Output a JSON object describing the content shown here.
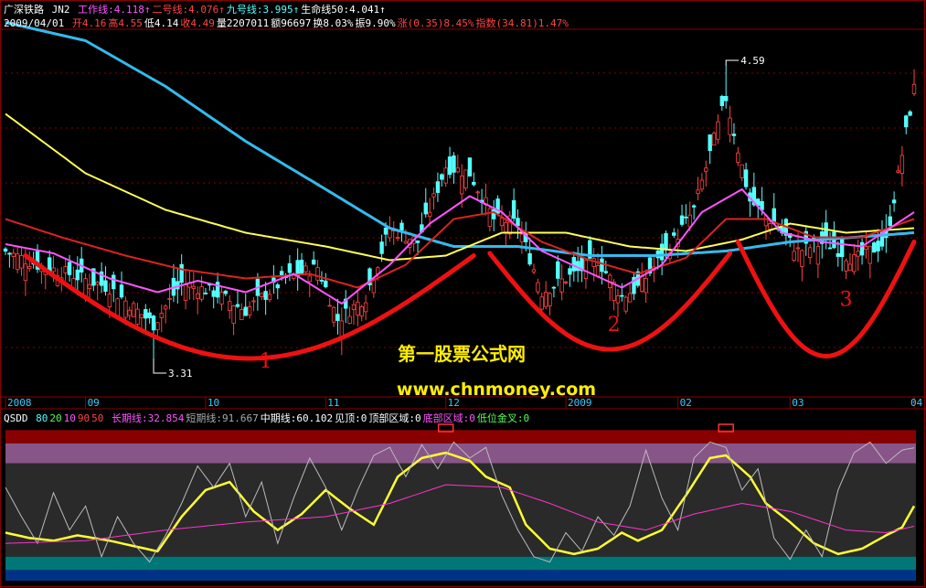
{
  "header": {
    "stock_name": "广深铁路",
    "formula": "JN2",
    "lines": [
      {
        "label": "工作线:",
        "value": "4.118",
        "arrow": "↑",
        "color": "#ff55ff"
      },
      {
        "label": "二号线:",
        "value": "4.076",
        "arrow": "↑",
        "color": "#ff4444"
      },
      {
        "label": "九号线:",
        "value": "3.995",
        "arrow": "↑",
        "color": "#55ffff"
      },
      {
        "label": "生命线50:",
        "value": "4.041",
        "arrow": "↑",
        "color": "#ffffff"
      }
    ]
  },
  "ohlc_bar": {
    "date": "2009/04/01",
    "items": [
      {
        "label": "开",
        "value": "4.16",
        "color": "#ff4444"
      },
      {
        "label": "高",
        "value": "4.55",
        "color": "#ff4444"
      },
      {
        "label": "低",
        "value": "4.14",
        "color": "#ffffff"
      },
      {
        "label": "收",
        "value": "4.49",
        "color": "#ff4444"
      },
      {
        "label": "量",
        "value": "2207011",
        "color": "#ffffff"
      },
      {
        "label": "额",
        "value": "96697",
        "color": "#ffffff"
      },
      {
        "label": "换",
        "value": "8.03%",
        "color": "#ffffff"
      },
      {
        "label": "振",
        "value": "9.90%",
        "color": "#ffffff"
      },
      {
        "label": "涨",
        "value": "(0.35)8.45%",
        "color": "#ff4444"
      },
      {
        "label": "指数",
        "value": "(34.81)1.47%",
        "color": "#ff4444"
      }
    ]
  },
  "indicator_bar": {
    "name": "QSDD",
    "params": [
      {
        "value": "80",
        "color": "#55ffff"
      },
      {
        "value": "20",
        "color": "#55ff55"
      },
      {
        "value": "10",
        "color": "#ff55ff"
      },
      {
        "value": "90",
        "color": "#ff4444"
      },
      {
        "value": "50",
        "color": "#ff4444"
      }
    ],
    "items": [
      {
        "label": "长期线:",
        "value": "32.854",
        "color": "#ff55ff"
      },
      {
        "label": "短期线:",
        "value": "91.667",
        "color": "#aaaaaa"
      },
      {
        "label": "中期线:",
        "value": "60.102",
        "color": "#ffffff"
      },
      {
        "label": "见顶:",
        "value": "0",
        "color": "#ffffff"
      },
      {
        "label": "顶部区域:",
        "value": "0",
        "color": "#ffffff"
      },
      {
        "label": "底部区域:",
        "value": "0",
        "color": "#ff55ff"
      },
      {
        "label": "低位金叉:",
        "value": "0",
        "color": "#55ff55"
      }
    ]
  },
  "watermark": {
    "line1": "第一股票公式网",
    "line2": "www.chnmoney.com",
    "color": "#ffee00"
  },
  "annotations": [
    {
      "text": "1",
      "x_index": 65,
      "y_price": 3.27
    },
    {
      "text": "2",
      "x_index": 152,
      "y_price": 3.43
    },
    {
      "text": "3",
      "x_index": 210,
      "y_price": 3.54
    }
  ],
  "colors": {
    "up": "#ff4444",
    "down": "#55ffff",
    "ma_work": "#ff55ff",
    "ma_two": "#dd2222",
    "ma_nine": "#33aaff",
    "ma_life": "#ffff55",
    "ma_long": "#33bbee",
    "bowl": "#ee1111",
    "grid": "#880000",
    "kdj_yellow": "#ffff33",
    "kdj_gray": "#bbbbbb",
    "kdj_magenta": "#ff33cc"
  },
  "chart_data": [
    {
      "type": "candlestick",
      "x_tick_labels": [
        "2008",
        "09",
        "10",
        "11",
        "12",
        "2009",
        "02",
        "03",
        "04"
      ],
      "x_tick_index": [
        0,
        20,
        50,
        80,
        110,
        140,
        168,
        196,
        227
      ],
      "ylim": [
        3.15,
        4.75
      ],
      "high_label": {
        "text": "4.59",
        "index": 180,
        "price": 4.59
      },
      "low_label": {
        "text": "3.31",
        "index": 37,
        "price": 3.31
      },
      "candles_count": 228,
      "close_anchors": [
        [
          0,
          3.78
        ],
        [
          8,
          3.72
        ],
        [
          16,
          3.68
        ],
        [
          26,
          3.62
        ],
        [
          37,
          3.46
        ],
        [
          44,
          3.64
        ],
        [
          52,
          3.6
        ],
        [
          60,
          3.52
        ],
        [
          70,
          3.66
        ],
        [
          78,
          3.71
        ],
        [
          83,
          3.48
        ],
        [
          90,
          3.58
        ],
        [
          96,
          3.88
        ],
        [
          103,
          3.82
        ],
        [
          110,
          4.15
        ],
        [
          116,
          4.12
        ],
        [
          122,
          3.92
        ],
        [
          128,
          3.9
        ],
        [
          134,
          3.6
        ],
        [
          140,
          3.66
        ],
        [
          148,
          3.74
        ],
        [
          154,
          3.58
        ],
        [
          158,
          3.62
        ],
        [
          166,
          3.8
        ],
        [
          172,
          3.96
        ],
        [
          180,
          4.45
        ],
        [
          186,
          4.0
        ],
        [
          192,
          3.9
        ],
        [
          198,
          3.78
        ],
        [
          205,
          3.82
        ],
        [
          212,
          3.74
        ],
        [
          220,
          3.82
        ],
        [
          227,
          4.49
        ]
      ],
      "ma_work_anchors": [
        [
          0,
          3.81
        ],
        [
          12,
          3.77
        ],
        [
          26,
          3.66
        ],
        [
          38,
          3.6
        ],
        [
          48,
          3.65
        ],
        [
          60,
          3.6
        ],
        [
          72,
          3.68
        ],
        [
          84,
          3.55
        ],
        [
          96,
          3.72
        ],
        [
          106,
          3.9
        ],
        [
          116,
          4.02
        ],
        [
          124,
          3.95
        ],
        [
          134,
          3.78
        ],
        [
          144,
          3.7
        ],
        [
          154,
          3.62
        ],
        [
          164,
          3.72
        ],
        [
          174,
          3.95
        ],
        [
          184,
          4.05
        ],
        [
          194,
          3.86
        ],
        [
          204,
          3.82
        ],
        [
          214,
          3.8
        ],
        [
          227,
          3.95
        ]
      ],
      "ma_two_anchors": [
        [
          0,
          3.92
        ],
        [
          14,
          3.84
        ],
        [
          30,
          3.76
        ],
        [
          44,
          3.7
        ],
        [
          60,
          3.66
        ],
        [
          76,
          3.68
        ],
        [
          88,
          3.62
        ],
        [
          100,
          3.72
        ],
        [
          112,
          3.92
        ],
        [
          122,
          3.95
        ],
        [
          134,
          3.82
        ],
        [
          146,
          3.74
        ],
        [
          158,
          3.68
        ],
        [
          170,
          3.75
        ],
        [
          180,
          3.92
        ],
        [
          190,
          3.92
        ],
        [
          202,
          3.84
        ],
        [
          214,
          3.84
        ],
        [
          227,
          3.92
        ]
      ],
      "ma_life_anchors": [
        [
          0,
          4.38
        ],
        [
          20,
          4.12
        ],
        [
          40,
          3.96
        ],
        [
          60,
          3.86
        ],
        [
          80,
          3.8
        ],
        [
          96,
          3.74
        ],
        [
          110,
          3.76
        ],
        [
          124,
          3.86
        ],
        [
          140,
          3.86
        ],
        [
          156,
          3.8
        ],
        [
          170,
          3.78
        ],
        [
          184,
          3.83
        ],
        [
          196,
          3.9
        ],
        [
          210,
          3.86
        ],
        [
          227,
          3.88
        ]
      ],
      "ma_long_anchors": [
        [
          0,
          4.78
        ],
        [
          20,
          4.7
        ],
        [
          40,
          4.5
        ],
        [
          60,
          4.26
        ],
        [
          80,
          4.05
        ],
        [
          96,
          3.88
        ],
        [
          112,
          3.8
        ],
        [
          128,
          3.8
        ],
        [
          146,
          3.76
        ],
        [
          162,
          3.76
        ],
        [
          180,
          3.78
        ],
        [
          196,
          3.82
        ],
        [
          212,
          3.84
        ],
        [
          227,
          3.86
        ]
      ]
    },
    {
      "type": "line",
      "title": "QSDD",
      "ylim": [
        -8,
        110
      ],
      "bands": [
        {
          "from": 95,
          "to": 105,
          "color": "#880000"
        },
        {
          "from": 80,
          "to": 95,
          "color": "#885588"
        },
        {
          "from": 10,
          "to": 80,
          "color": "#2a2a2a"
        },
        {
          "from": 0,
          "to": 10,
          "color": "#007777"
        },
        {
          "from": -8,
          "to": 0,
          "color": "#003388"
        }
      ],
      "series": [
        {
          "name": "中期线",
          "anchors": [
            [
              0,
              28
            ],
            [
              6,
              24
            ],
            [
              12,
              22
            ],
            [
              18,
              26
            ],
            [
              26,
              22
            ],
            [
              32,
              18
            ],
            [
              38,
              14
            ],
            [
              44,
              40
            ],
            [
              50,
              60
            ],
            [
              56,
              66
            ],
            [
              62,
              44
            ],
            [
              68,
              30
            ],
            [
              74,
              42
            ],
            [
              80,
              60
            ],
            [
              86,
              46
            ],
            [
              92,
              34
            ],
            [
              98,
              70
            ],
            [
              104,
              84
            ],
            [
              110,
              88
            ],
            [
              116,
              82
            ],
            [
              120,
              70
            ],
            [
              126,
              62
            ],
            [
              130,
              34
            ],
            [
              136,
              16
            ],
            [
              142,
              12
            ],
            [
              148,
              16
            ],
            [
              154,
              28
            ],
            [
              158,
              22
            ],
            [
              164,
              30
            ],
            [
              170,
              56
            ],
            [
              176,
              84
            ],
            [
              180,
              86
            ],
            [
              186,
              70
            ],
            [
              190,
              50
            ],
            [
              196,
              36
            ],
            [
              202,
              20
            ],
            [
              208,
              12
            ],
            [
              214,
              16
            ],
            [
              220,
              26
            ],
            [
              224,
              32
            ],
            [
              227,
              48
            ]
          ]
        },
        {
          "name": "短期线",
          "anchors": [
            [
              0,
              62
            ],
            [
              4,
              40
            ],
            [
              8,
              20
            ],
            [
              12,
              58
            ],
            [
              16,
              30
            ],
            [
              20,
              48
            ],
            [
              24,
              10
            ],
            [
              28,
              40
            ],
            [
              32,
              20
            ],
            [
              36,
              6
            ],
            [
              40,
              26
            ],
            [
              44,
              50
            ],
            [
              48,
              78
            ],
            [
              52,
              62
            ],
            [
              56,
              80
            ],
            [
              60,
              40
            ],
            [
              64,
              66
            ],
            [
              68,
              20
            ],
            [
              72,
              54
            ],
            [
              76,
              84
            ],
            [
              80,
              62
            ],
            [
              84,
              30
            ],
            [
              88,
              60
            ],
            [
              92,
              86
            ],
            [
              96,
              92
            ],
            [
              100,
              70
            ],
            [
              104,
              94
            ],
            [
              108,
              76
            ],
            [
              112,
              96
            ],
            [
              116,
              84
            ],
            [
              120,
              92
            ],
            [
              124,
              56
            ],
            [
              128,
              30
            ],
            [
              132,
              10
            ],
            [
              136,
              6
            ],
            [
              140,
              28
            ],
            [
              144,
              14
            ],
            [
              148,
              40
            ],
            [
              152,
              26
            ],
            [
              156,
              48
            ],
            [
              160,
              90
            ],
            [
              164,
              54
            ],
            [
              168,
              30
            ],
            [
              172,
              84
            ],
            [
              176,
              96
            ],
            [
              180,
              92
            ],
            [
              184,
              60
            ],
            [
              188,
              76
            ],
            [
              192,
              24
            ],
            [
              196,
              8
            ],
            [
              200,
              30
            ],
            [
              204,
              10
            ],
            [
              208,
              60
            ],
            [
              212,
              88
            ],
            [
              216,
              96
            ],
            [
              220,
              80
            ],
            [
              224,
              90
            ],
            [
              227,
              91.667
            ]
          ]
        },
        {
          "name": "长期线",
          "anchors": [
            [
              0,
              20
            ],
            [
              20,
              22
            ],
            [
              40,
              30
            ],
            [
              60,
              36
            ],
            [
              80,
              40
            ],
            [
              96,
              50
            ],
            [
              110,
              64
            ],
            [
              124,
              62
            ],
            [
              136,
              50
            ],
            [
              148,
              36
            ],
            [
              160,
              30
            ],
            [
              172,
              42
            ],
            [
              184,
              50
            ],
            [
              196,
              44
            ],
            [
              210,
              30
            ],
            [
              220,
              28
            ],
            [
              227,
              32.854
            ]
          ]
        }
      ]
    }
  ]
}
